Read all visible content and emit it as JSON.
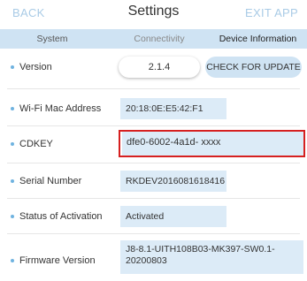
{
  "header": {
    "back_label": "BACK",
    "title": "Settings",
    "exit_label": "EXIT APP"
  },
  "tabs": [
    {
      "label": "System"
    },
    {
      "label": "Connectivity"
    },
    {
      "label": "Device Information",
      "active": true
    }
  ],
  "version": {
    "label": "Version",
    "value": "2.1.4",
    "button_label": "CHECK FOR UPDATE"
  },
  "rows": {
    "wifi_mac": {
      "label": "Wi-Fi Mac Address",
      "value": "20:18:0E:E5:42:F1"
    },
    "cdkey": {
      "label": "CDKEY",
      "value": "dfe0-6002-4a1d- xxxx"
    },
    "serial": {
      "label": "Serial Number",
      "value": "RKDEV2016081618416"
    },
    "activation": {
      "label": "Status of Activation",
      "value": "Activated"
    },
    "firmware": {
      "label": "Firmware Version",
      "value": "J8-8.1-UITH108B03-MK397-SW0.1-20200803"
    }
  },
  "colors": {
    "accent_text": "#a9cbe6",
    "tab_bar": "#cfe3f3",
    "value_bg": "#dcebf7",
    "bullet": "#6fb3e0",
    "highlight_border": "#d62020"
  }
}
